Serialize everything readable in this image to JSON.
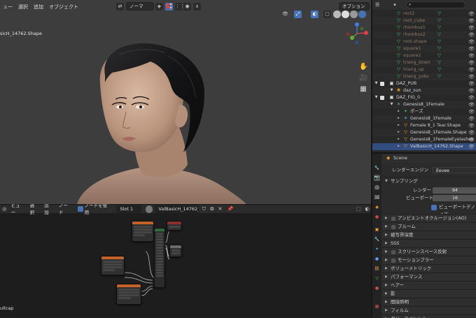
{
  "viewport": {
    "menu": [
      "ュー",
      "選択",
      "追加",
      "オブジェクト"
    ],
    "shading_label": "ノーマ",
    "options_label": "オプション",
    "object_name": "sicH_14762.Shape"
  },
  "node_editor": {
    "menu": [
      "ビュー",
      "選択",
      "追加",
      "ノード"
    ],
    "use_nodes_label": "ノードを使用",
    "slot": "Slot 1",
    "material": "ValBasicH_14762_",
    "footer_text": "ullcap"
  },
  "outliner": {
    "rows": [
      {
        "text": "rect2",
        "indent": 2,
        "icon": "shape-icon",
        "dim": true
      },
      {
        "text": "root_cube",
        "indent": 2,
        "icon": "shape-icon",
        "dim": true
      },
      {
        "text": "rhombus1",
        "indent": 2,
        "icon": "shape-icon",
        "dim": true
      },
      {
        "text": "rhombus2",
        "indent": 2,
        "icon": "shape-icon",
        "dim": true
      },
      {
        "text": "root.shape",
        "indent": 2,
        "icon": "shape-icon",
        "dim": true
      },
      {
        "text": "square1",
        "indent": 2,
        "icon": "shape-icon",
        "dim": true
      },
      {
        "text": "square2",
        "indent": 2,
        "icon": "shape-icon",
        "dim": true
      },
      {
        "text": "triang_down",
        "indent": 2,
        "icon": "shape-icon",
        "dim": true
      },
      {
        "text": "triang_up",
        "indent": 2,
        "icon": "shape-icon",
        "dim": true
      },
      {
        "text": "triang_yoko",
        "indent": 2,
        "icon": "shape-icon",
        "dim": true
      },
      {
        "text": "DAZ_PUB",
        "indent": 1,
        "icon": "collection-icon",
        "dim": false
      },
      {
        "text": "daz_sun",
        "indent": 2,
        "icon": "light-icon",
        "dim": false
      },
      {
        "text": "DAZ_FIG_0",
        "indent": 1,
        "icon": "collection-icon",
        "dim": false
      },
      {
        "text": "Genesis8_1Female",
        "indent": 2,
        "icon": "armature-icon",
        "dim": false
      },
      {
        "text": "ポーズ",
        "indent": 3,
        "icon": "pose-icon",
        "dim": false
      },
      {
        "text": "Genesis8_1Female",
        "indent": 3,
        "icon": "armature-icon",
        "dim": false
      },
      {
        "text": "Female 8_1 Tear.Shape",
        "indent": 3,
        "icon": "mesh-icon",
        "dim": false
      },
      {
        "text": "Genesis8_1Female.Shape",
        "indent": 3,
        "icon": "mesh-icon",
        "dim": false
      },
      {
        "text": "Genesis8_1FemaleEyelashes",
        "indent": 3,
        "icon": "mesh-icon",
        "dim": false
      },
      {
        "text": "ValBasicH_14762.Shape",
        "indent": 3,
        "icon": "mesh-icon",
        "dim": false
      }
    ]
  },
  "properties": {
    "scene_label": "Scene",
    "render_engine_label": "レンダーエンジン",
    "render_engine_value": "Eevee",
    "sampling_label": "サンプリング",
    "render_label": "レンダー",
    "render_value": "64",
    "viewport_label": "ビューポート",
    "viewport_value": "16",
    "denoise_label": "ビューポートデノイズ",
    "panels": [
      {
        "label": "アンビエントオクルージョン(AO)",
        "checkbox": true
      },
      {
        "label": "ブルーム",
        "checkbox": true
      },
      {
        "label": "被写界深度",
        "checkbox": false
      },
      {
        "label": "SSS",
        "checkbox": false
      },
      {
        "label": "スクリーンスペース反射",
        "checkbox": true
      },
      {
        "label": "モーションブラー",
        "checkbox": true
      },
      {
        "label": "ボリューメトリック",
        "checkbox": false
      },
      {
        "label": "パフォーマンス",
        "checkbox": false
      },
      {
        "label": "ヘアー",
        "checkbox": false
      },
      {
        "label": "影",
        "checkbox": false
      },
      {
        "label": "間接照明",
        "checkbox": false
      },
      {
        "label": "フィルム",
        "checkbox": false
      },
      {
        "label": "グリースペンシル",
        "checkbox": false
      }
    ]
  },
  "colors": {
    "accent": "#4772b3",
    "selected_row": "#334d80",
    "node_orange": "#c5622a",
    "node_red": "#8a3030",
    "node_gray": "#6b6b6b",
    "gizmo_x": "#e0404f",
    "gizmo_y": "#6da93a",
    "gizmo_z": "#3f7fe0"
  }
}
